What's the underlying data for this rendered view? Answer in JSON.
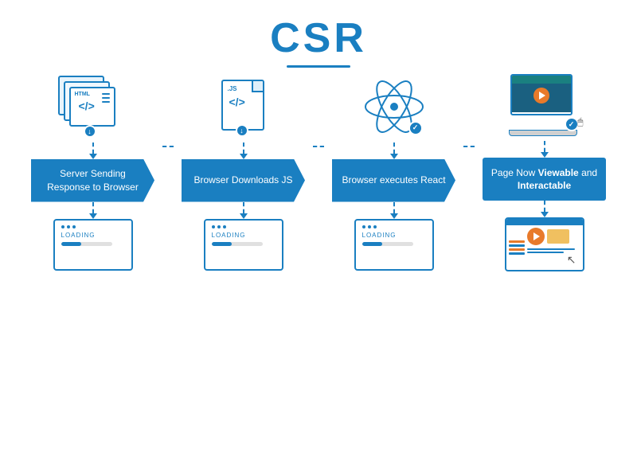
{
  "title": "CSR",
  "steps": [
    {
      "id": "step1",
      "icon_type": "html_stack",
      "box_label": "Server Sending Response to Browser",
      "box_bold": "",
      "screen_type": "loading",
      "loading_text": "LOADING"
    },
    {
      "id": "step2",
      "icon_type": "js_file",
      "box_label": "Browser Downloads JS",
      "box_bold": "",
      "screen_type": "loading",
      "loading_text": "LOADING"
    },
    {
      "id": "step3",
      "icon_type": "atom",
      "box_label": "Browser executes React",
      "box_bold": "",
      "screen_type": "loading",
      "loading_text": "LOADING"
    },
    {
      "id": "step4",
      "icon_type": "laptop",
      "box_label_prefix": "Page Now ",
      "box_bold1": "Viewable",
      "box_label_mid": " and ",
      "box_bold2": "Interactable",
      "screen_type": "full",
      "loading_text": ""
    }
  ],
  "colors": {
    "blue": "#1a7fc1",
    "orange": "#e87a2a",
    "white": "#ffffff"
  }
}
